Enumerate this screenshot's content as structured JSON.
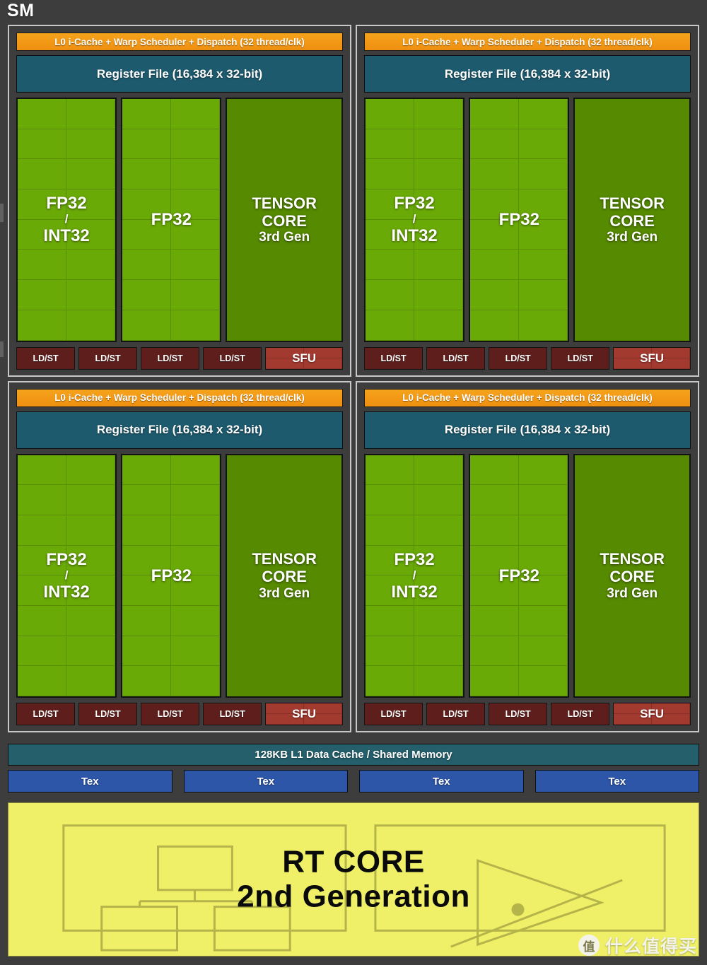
{
  "diagram": {
    "title": "SM",
    "type": "gpu-sm-block-diagram"
  },
  "colors": {
    "background": "#3d3d3d",
    "quadrant_border": "#c8c8c8",
    "scheduler": "#f0940f",
    "register_file": "#1d5a6e",
    "fp32": "#6aaa07",
    "tensor_core": "#568a00",
    "ldst": "#5e1f1c",
    "sfu": "#a33a30",
    "l1_cache": "#245f6b",
    "tex": "#2d55a8",
    "rt_core": "#eff068",
    "rt_core_text": "#0a0a0a"
  },
  "processing_blocks": [
    {
      "scheduler": "L0 i-Cache + Warp Scheduler + Dispatch (32 thread/clk)",
      "register_file": "Register File (16,384 x 32-bit)",
      "units": [
        {
          "kind": "fp32-int32",
          "line1": "FP32",
          "slash": "/",
          "line2": "INT32"
        },
        {
          "kind": "fp32",
          "line1": "FP32"
        },
        {
          "kind": "tensor",
          "line1": "TENSOR",
          "line2": "CORE",
          "gen": "3rd Gen"
        }
      ],
      "ldst": [
        "LD/ST",
        "LD/ST",
        "LD/ST",
        "LD/ST"
      ],
      "sfu": "SFU"
    },
    {
      "scheduler": "L0 i-Cache + Warp Scheduler + Dispatch (32 thread/clk)",
      "register_file": "Register File (16,384 x 32-bit)",
      "units": [
        {
          "kind": "fp32-int32",
          "line1": "FP32",
          "slash": "/",
          "line2": "INT32"
        },
        {
          "kind": "fp32",
          "line1": "FP32"
        },
        {
          "kind": "tensor",
          "line1": "TENSOR",
          "line2": "CORE",
          "gen": "3rd Gen"
        }
      ],
      "ldst": [
        "LD/ST",
        "LD/ST",
        "LD/ST",
        "LD/ST"
      ],
      "sfu": "SFU"
    },
    {
      "scheduler": "L0 i-Cache + Warp Scheduler + Dispatch (32 thread/clk)",
      "register_file": "Register File (16,384 x 32-bit)",
      "units": [
        {
          "kind": "fp32-int32",
          "line1": "FP32",
          "slash": "/",
          "line2": "INT32"
        },
        {
          "kind": "fp32",
          "line1": "FP32"
        },
        {
          "kind": "tensor",
          "line1": "TENSOR",
          "line2": "CORE",
          "gen": "3rd Gen"
        }
      ],
      "ldst": [
        "LD/ST",
        "LD/ST",
        "LD/ST",
        "LD/ST"
      ],
      "sfu": "SFU"
    },
    {
      "scheduler": "L0 i-Cache + Warp Scheduler + Dispatch (32 thread/clk)",
      "register_file": "Register File (16,384 x 32-bit)",
      "units": [
        {
          "kind": "fp32-int32",
          "line1": "FP32",
          "slash": "/",
          "line2": "INT32"
        },
        {
          "kind": "fp32",
          "line1": "FP32"
        },
        {
          "kind": "tensor",
          "line1": "TENSOR",
          "line2": "CORE",
          "gen": "3rd Gen"
        }
      ],
      "ldst": [
        "LD/ST",
        "LD/ST",
        "LD/ST",
        "LD/ST"
      ],
      "sfu": "SFU"
    }
  ],
  "l1_cache": {
    "label": "128KB L1 Data Cache / Shared Memory"
  },
  "tex_units": [
    {
      "label": "Tex"
    },
    {
      "label": "Tex"
    },
    {
      "label": "Tex"
    },
    {
      "label": "Tex"
    }
  ],
  "rt_core": {
    "line1": "RT CORE",
    "line2": "2nd Generation",
    "left_graphic": "bvh-tree-icon",
    "right_graphic": "ray-triangle-intersection-icon"
  },
  "watermark": {
    "logo_char": "值",
    "text": "什么值得买"
  }
}
